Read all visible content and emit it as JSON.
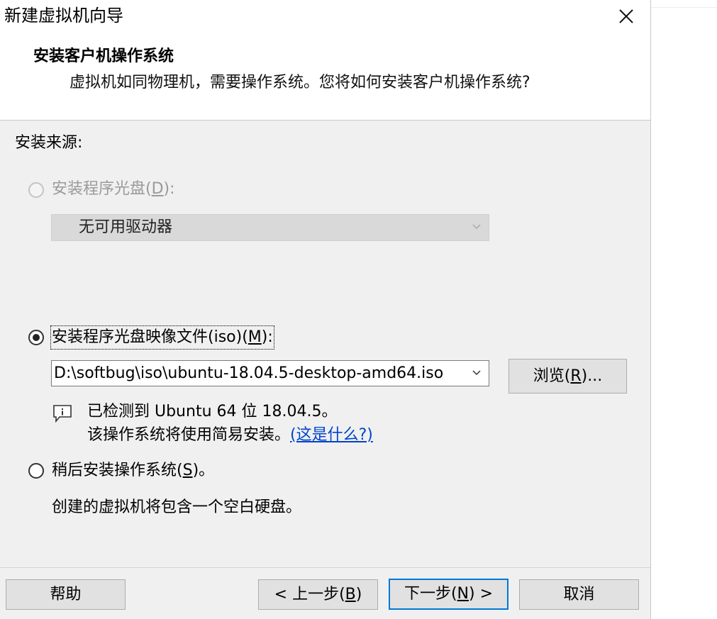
{
  "window": {
    "title": "新建虚拟机向导"
  },
  "header": {
    "title": "安装客户机操作系统",
    "subtitle": "虚拟机如同物理机，需要操作系统。您将如何安装客户机操作系统?"
  },
  "install_source": {
    "label": "安装来源:",
    "disc_option": {
      "label_pre": "安装程序光盘(",
      "mnemonic": "D",
      "label_post": "):",
      "selected": false,
      "enabled": false,
      "drive_value": "无可用驱动器"
    },
    "iso_option": {
      "label_pre": "安装程序光盘映像文件(iso)(",
      "mnemonic": "M",
      "label_post": "):",
      "selected": true,
      "path_value": "D:\\softbug\\iso\\ubuntu-18.04.5-desktop-amd64.iso",
      "browse_pre": "浏览(",
      "browse_mnemonic": "R",
      "browse_post": ")..."
    },
    "detection": {
      "line1": "已检测到 Ubuntu 64 位 18.04.5。",
      "line2": "该操作系统将使用简易安装。",
      "link": "(这是什么?)"
    },
    "later_option": {
      "label_pre": "稍后安装操作系统(",
      "mnemonic": "S",
      "label_post": ")。",
      "selected": false,
      "description": "创建的虚拟机将包含一个空白硬盘。"
    }
  },
  "footer": {
    "help": "帮助",
    "back_pre": "< 上一步(",
    "back_mnemonic": "B",
    "back_post": ")",
    "next_pre": "下一步(",
    "next_mnemonic": "N",
    "next_post": ") >",
    "cancel": "取消"
  },
  "colors": {
    "accent": "#0078d7",
    "link": "#0044cc",
    "panel_bg": "#f0f0f0"
  }
}
